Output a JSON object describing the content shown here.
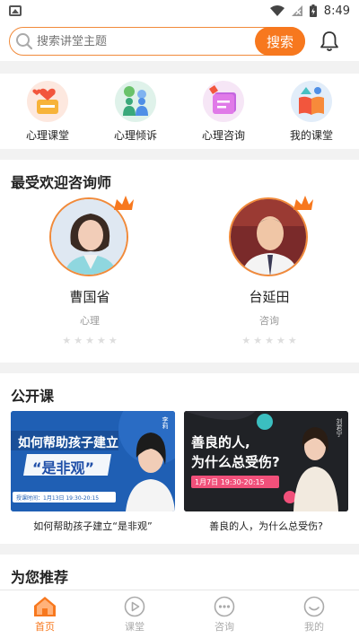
{
  "status_bar": {
    "time": "8:49"
  },
  "search": {
    "placeholder": "搜索讲堂主题",
    "button": "搜索"
  },
  "quick_nav": [
    {
      "label": "心理课堂",
      "icon": "heart-class-icon"
    },
    {
      "label": "心理倾诉",
      "icon": "people-talk-icon"
    },
    {
      "label": "心理咨询",
      "icon": "consult-document-icon"
    },
    {
      "label": "我的课堂",
      "icon": "my-class-book-icon"
    }
  ],
  "experts_section": {
    "title": "最受欢迎咨询师",
    "items": [
      {
        "name": "曹国省",
        "field": "心理",
        "rating": 0
      },
      {
        "name": "台延田",
        "field": "咨询",
        "rating": 0
      }
    ]
  },
  "courses_section": {
    "title": "公开课",
    "items": [
      {
        "title": "如何帮助孩子建立“是非观”",
        "banner_line1": "如何帮助孩子建立",
        "banner_line2": "“是非观”",
        "banner_time": "授课时间：1月13日 19:30-20:15",
        "speaker": "李莉"
      },
      {
        "title": "善良的人，为什么总受伤?",
        "banner_line1": "善良的人,",
        "banner_line2": "为什么总受伤?",
        "banner_time": "1月7日 19:30-20:15",
        "speaker": "刘君宁"
      }
    ]
  },
  "recommend_section": {
    "title": "为您推荐"
  },
  "tab_bar": [
    {
      "label": "首页",
      "active": true
    },
    {
      "label": "课堂",
      "active": false
    },
    {
      "label": "咨询",
      "active": false
    },
    {
      "label": "我的",
      "active": false
    }
  ],
  "colors": {
    "accent": "#f7781e",
    "accent_border": "#f18a3a"
  }
}
